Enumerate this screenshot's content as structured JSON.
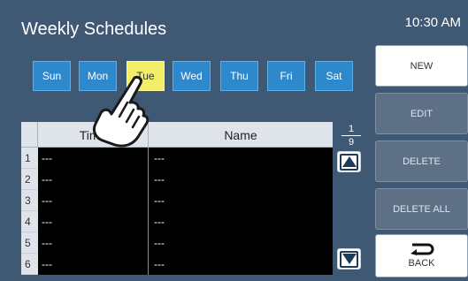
{
  "header": {
    "title": "Weekly Schedules",
    "clock": "10:30 AM"
  },
  "days": [
    {
      "label": "Sun",
      "active": false
    },
    {
      "label": "Mon",
      "active": false
    },
    {
      "label": "Tue",
      "active": true
    },
    {
      "label": "Wed",
      "active": false
    },
    {
      "label": "Thu",
      "active": false
    },
    {
      "label": "Fri",
      "active": false
    },
    {
      "label": "Sat",
      "active": false
    }
  ],
  "table": {
    "columns": {
      "time": "Time",
      "name": "Name"
    },
    "rows": [
      {
        "num": "1",
        "time": "---",
        "name": "---"
      },
      {
        "num": "2",
        "time": "---",
        "name": "---"
      },
      {
        "num": "3",
        "time": "---",
        "name": "---"
      },
      {
        "num": "4",
        "time": "---",
        "name": "---"
      },
      {
        "num": "5",
        "time": "---",
        "name": "---"
      },
      {
        "num": "6",
        "time": "---",
        "name": "---"
      }
    ]
  },
  "pager": {
    "current": "1",
    "total": "9"
  },
  "actions": {
    "new": "NEW",
    "edit": "EDIT",
    "delete": "DELETE",
    "delete_all": "DELETE ALL",
    "back": "BACK"
  },
  "colors": {
    "background": "#3f5873",
    "day_button": "#2e88cc",
    "day_selected": "#f2ee6a",
    "disabled_button": "#5e7086"
  },
  "icons": {
    "scroll_up": "up-arrow-icon",
    "scroll_down": "down-arrow-icon",
    "back": "back-arrow-icon",
    "pointer": "hand-pointer-icon"
  }
}
